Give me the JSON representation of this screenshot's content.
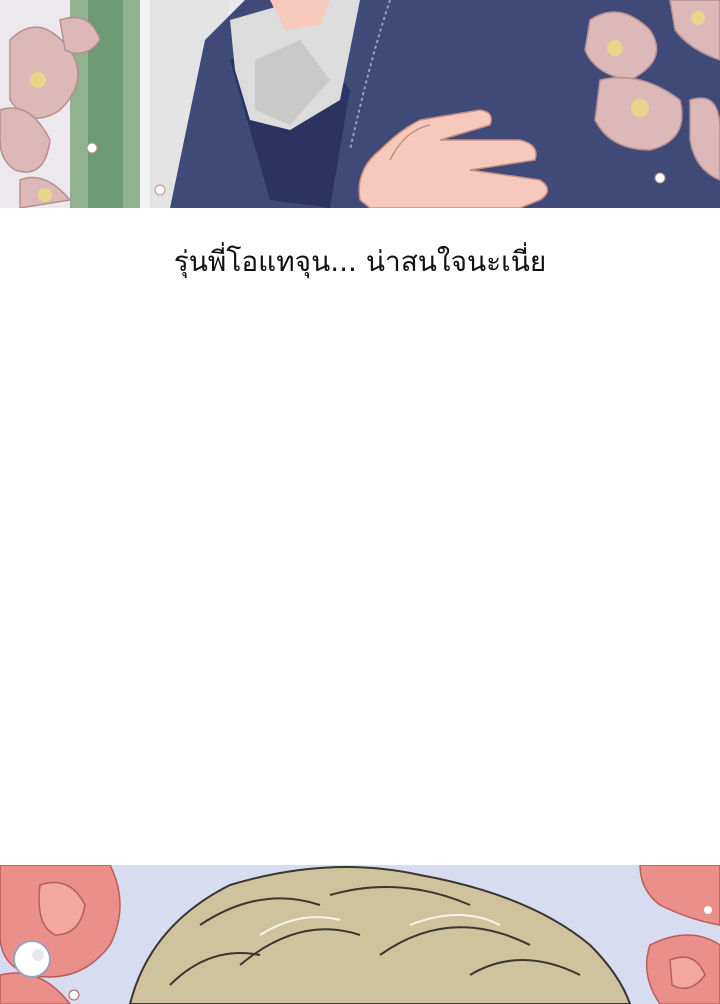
{
  "caption": "รุ่นพี่โอแทจุน... น่าสนใจนะเนี่ย",
  "colors": {
    "background": "#ffffff",
    "suit": "#3f4a78",
    "suit_dark": "#2b3460",
    "shirt": "#dcdcdc",
    "skin": "#f6c9bc",
    "blossom": "#dcb8b8",
    "blossom_center": "#e8d58a",
    "green_tie": "#6e9a74",
    "rose": "#ea8f89",
    "hair": "#cfc39d",
    "sky": "#d7dcf0"
  }
}
